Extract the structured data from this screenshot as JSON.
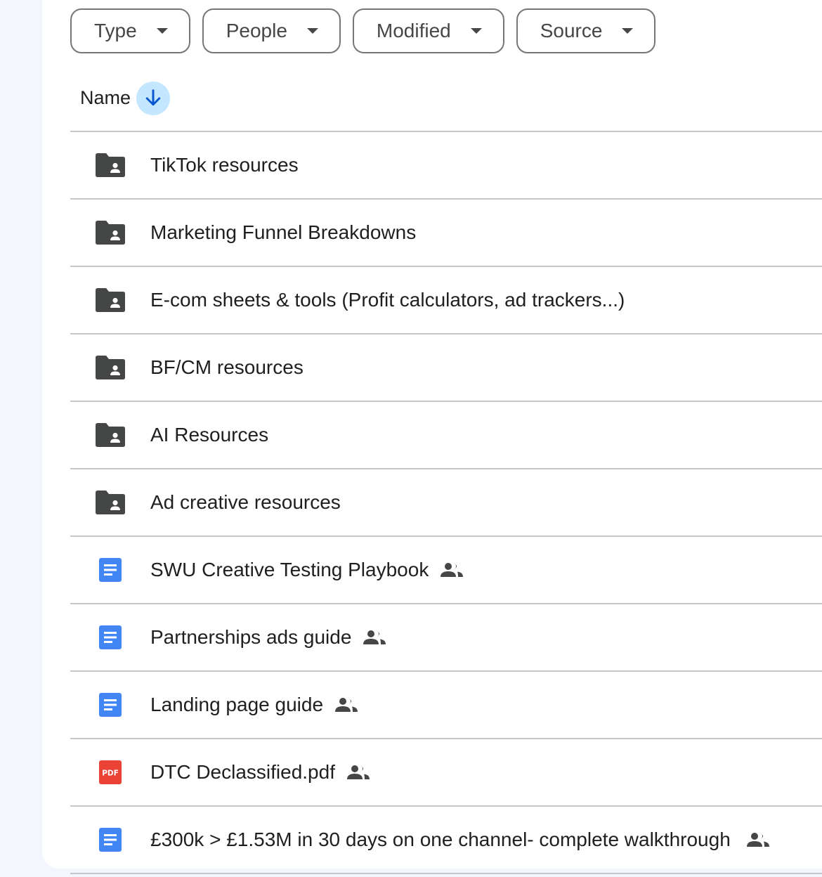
{
  "filters": [
    {
      "label": "Type"
    },
    {
      "label": "People"
    },
    {
      "label": "Modified"
    },
    {
      "label": "Source"
    }
  ],
  "header": {
    "name_label": "Name",
    "sort_icon": "arrow-down-icon"
  },
  "colors": {
    "folder": "#444746",
    "doc": "#4285f4",
    "pdf": "#ea4335",
    "sort_bg": "#c2e7ff",
    "sort_arrow": "#0b57d0"
  },
  "files": [
    {
      "name": "TikTok resources",
      "type": "shared-folder",
      "icon": "shared-folder-icon",
      "shared": false
    },
    {
      "name": "Marketing Funnel Breakdowns",
      "type": "shared-folder",
      "icon": "shared-folder-icon",
      "shared": false
    },
    {
      "name": "E-com sheets & tools (Profit calculators, ad trackers...)",
      "type": "shared-folder",
      "icon": "shared-folder-icon",
      "shared": false
    },
    {
      "name": "BF/CM resources",
      "type": "shared-folder",
      "icon": "shared-folder-icon",
      "shared": false
    },
    {
      "name": "AI Resources",
      "type": "shared-folder",
      "icon": "shared-folder-icon",
      "shared": false
    },
    {
      "name": "Ad creative resources",
      "type": "shared-folder",
      "icon": "shared-folder-icon",
      "shared": false
    },
    {
      "name": "SWU Creative Testing Playbook",
      "type": "doc",
      "icon": "google-docs-icon",
      "shared": true
    },
    {
      "name": "Partnerships ads guide",
      "type": "doc",
      "icon": "google-docs-icon",
      "shared": true
    },
    {
      "name": "Landing page guide",
      "type": "doc",
      "icon": "google-docs-icon",
      "shared": true
    },
    {
      "name": "DTC Declassified.pdf",
      "type": "pdf",
      "icon": "pdf-icon",
      "pdf_badge": "PDF",
      "shared": true
    },
    {
      "name": "£300k > £1.53M in 30 days on one channel- complete walkthrough",
      "type": "doc",
      "icon": "google-docs-icon",
      "shared": true
    }
  ]
}
